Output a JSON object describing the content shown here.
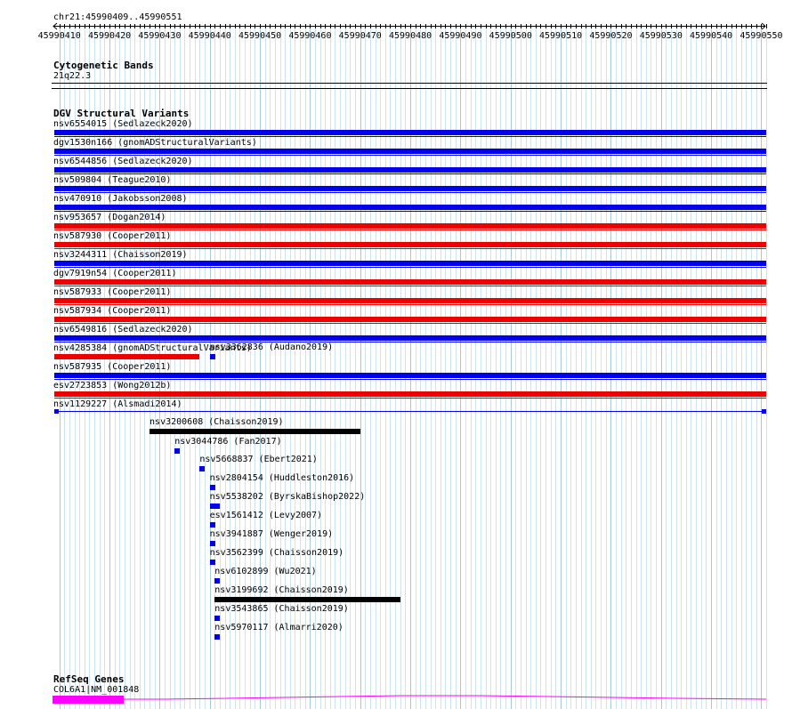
{
  "header": {
    "location": "chr21:45990409..45990551",
    "ticks": [
      "45990410",
      "45990420",
      "45990430",
      "45990440",
      "45990450",
      "45990460",
      "45990470",
      "45990480",
      "45990490",
      "45990500",
      "45990510",
      "45990520",
      "45990530",
      "45990540",
      "45990550"
    ]
  },
  "cytoband": {
    "title": "Cytogenetic Bands",
    "band": "21q22.3"
  },
  "dgv": {
    "title": "DGV Structural Variants",
    "colors": {
      "blue": "#0000ee",
      "red": "#ee0000",
      "black": "#000000"
    },
    "rows": [
      {
        "label": "nsv6554015 (Sedlazeck2020)",
        "color": "blue",
        "start": 45990409,
        "end": 45990551
      },
      {
        "label": "dgv1530n166 (gnomADStructuralVariants)",
        "color": "blue",
        "start": 45990409,
        "end": 45990551
      },
      {
        "label": "nsv6544856 (Sedlazeck2020)",
        "color": "blue",
        "start": 45990409,
        "end": 45990551
      },
      {
        "label": "nsv509804 (Teague2010)",
        "color": "blue",
        "start": 45990409,
        "end": 45990551
      },
      {
        "label": "nsv470910 (Jakobsson2008)",
        "color": "blue",
        "start": 45990409,
        "end": 45990551
      },
      {
        "label": "nsv953657 (Dogan2014)",
        "color": "red",
        "start": 45990409,
        "end": 45990551
      },
      {
        "label": "nsv587930 (Cooper2011)",
        "color": "red",
        "start": 45990409,
        "end": 45990551
      },
      {
        "label": "nsv3244311 (Chaisson2019)",
        "color": "blue",
        "start": 45990409,
        "end": 45990551
      },
      {
        "label": "dgv7919n54 (Cooper2011)",
        "color": "red",
        "start": 45990409,
        "end": 45990551
      },
      {
        "label": "nsv587933 (Cooper2011)",
        "color": "red",
        "start": 45990409,
        "end": 45990551
      },
      {
        "label": "nsv587934 (Cooper2011)",
        "color": "red",
        "start": 45990409,
        "end": 45990551
      },
      {
        "label": "nsv6549816 (Sedlazeck2020)",
        "color": "blue",
        "start": 45990409,
        "end": 45990551
      },
      {
        "label": "nsv4285384 (gnomADStructuralVariants)",
        "color": "red",
        "start": 45990409,
        "end": 45990438
      },
      {
        "label": "nsv587935 (Cooper2011)",
        "color": "blue",
        "start": 45990409,
        "end": 45990551
      },
      {
        "label": "esv2723853 (Wong2012b)",
        "color": "red",
        "start": 45990409,
        "end": 45990551
      },
      {
        "label": "nsv1129227 (Alsmadi2014)",
        "color": "blue",
        "start": 45990409,
        "end": 45990551
      }
    ],
    "extra_features": [
      {
        "label": "nsv3362836 (Audano2019)",
        "color": "blue",
        "start": 45990440,
        "end": 45990440
      },
      {
        "label": "nsv3200608 (Chaisson2019)",
        "color": "black",
        "start": 45990428,
        "end": 45990470
      },
      {
        "label": "nsv3044786 (Fan2017)",
        "color": "blue",
        "start": 45990433,
        "end": 45990433
      },
      {
        "label": "nsv5668837 (Ebert2021)",
        "color": "blue",
        "start": 45990438,
        "end": 45990438
      },
      {
        "label": "nsv2804154 (Huddleston2016)",
        "color": "blue",
        "start": 45990440,
        "end": 45990440
      },
      {
        "label": "nsv5538202 (ByrskaBishop2022)",
        "color": "blue",
        "start": 45990440,
        "end": 45990442
      },
      {
        "label": "esv1561412 (Levy2007)",
        "color": "blue",
        "start": 45990440,
        "end": 45990440
      },
      {
        "label": "nsv3941887 (Wenger2019)",
        "color": "blue",
        "start": 45990440,
        "end": 45990440
      },
      {
        "label": "nsv3562399 (Chaisson2019)",
        "color": "blue",
        "start": 45990440,
        "end": 45990440
      },
      {
        "label": "nsv6102899 (Wu2021)",
        "color": "blue",
        "start": 45990441,
        "end": 45990441
      },
      {
        "label": "nsv3199692 (Chaisson2019)",
        "color": "black",
        "start": 45990441,
        "end": 45990478
      },
      {
        "label": "nsv3543865 (Chaisson2019)",
        "color": "blue",
        "start": 45990441,
        "end": 45990441
      },
      {
        "label": "nsv5970117 (Almarri2020)",
        "color": "blue",
        "start": 45990441,
        "end": 45990441
      }
    ]
  },
  "refseq": {
    "title": "RefSeq Genes",
    "gene_label": "COL6A1|NM_001848",
    "color": "#ff00ff"
  }
}
